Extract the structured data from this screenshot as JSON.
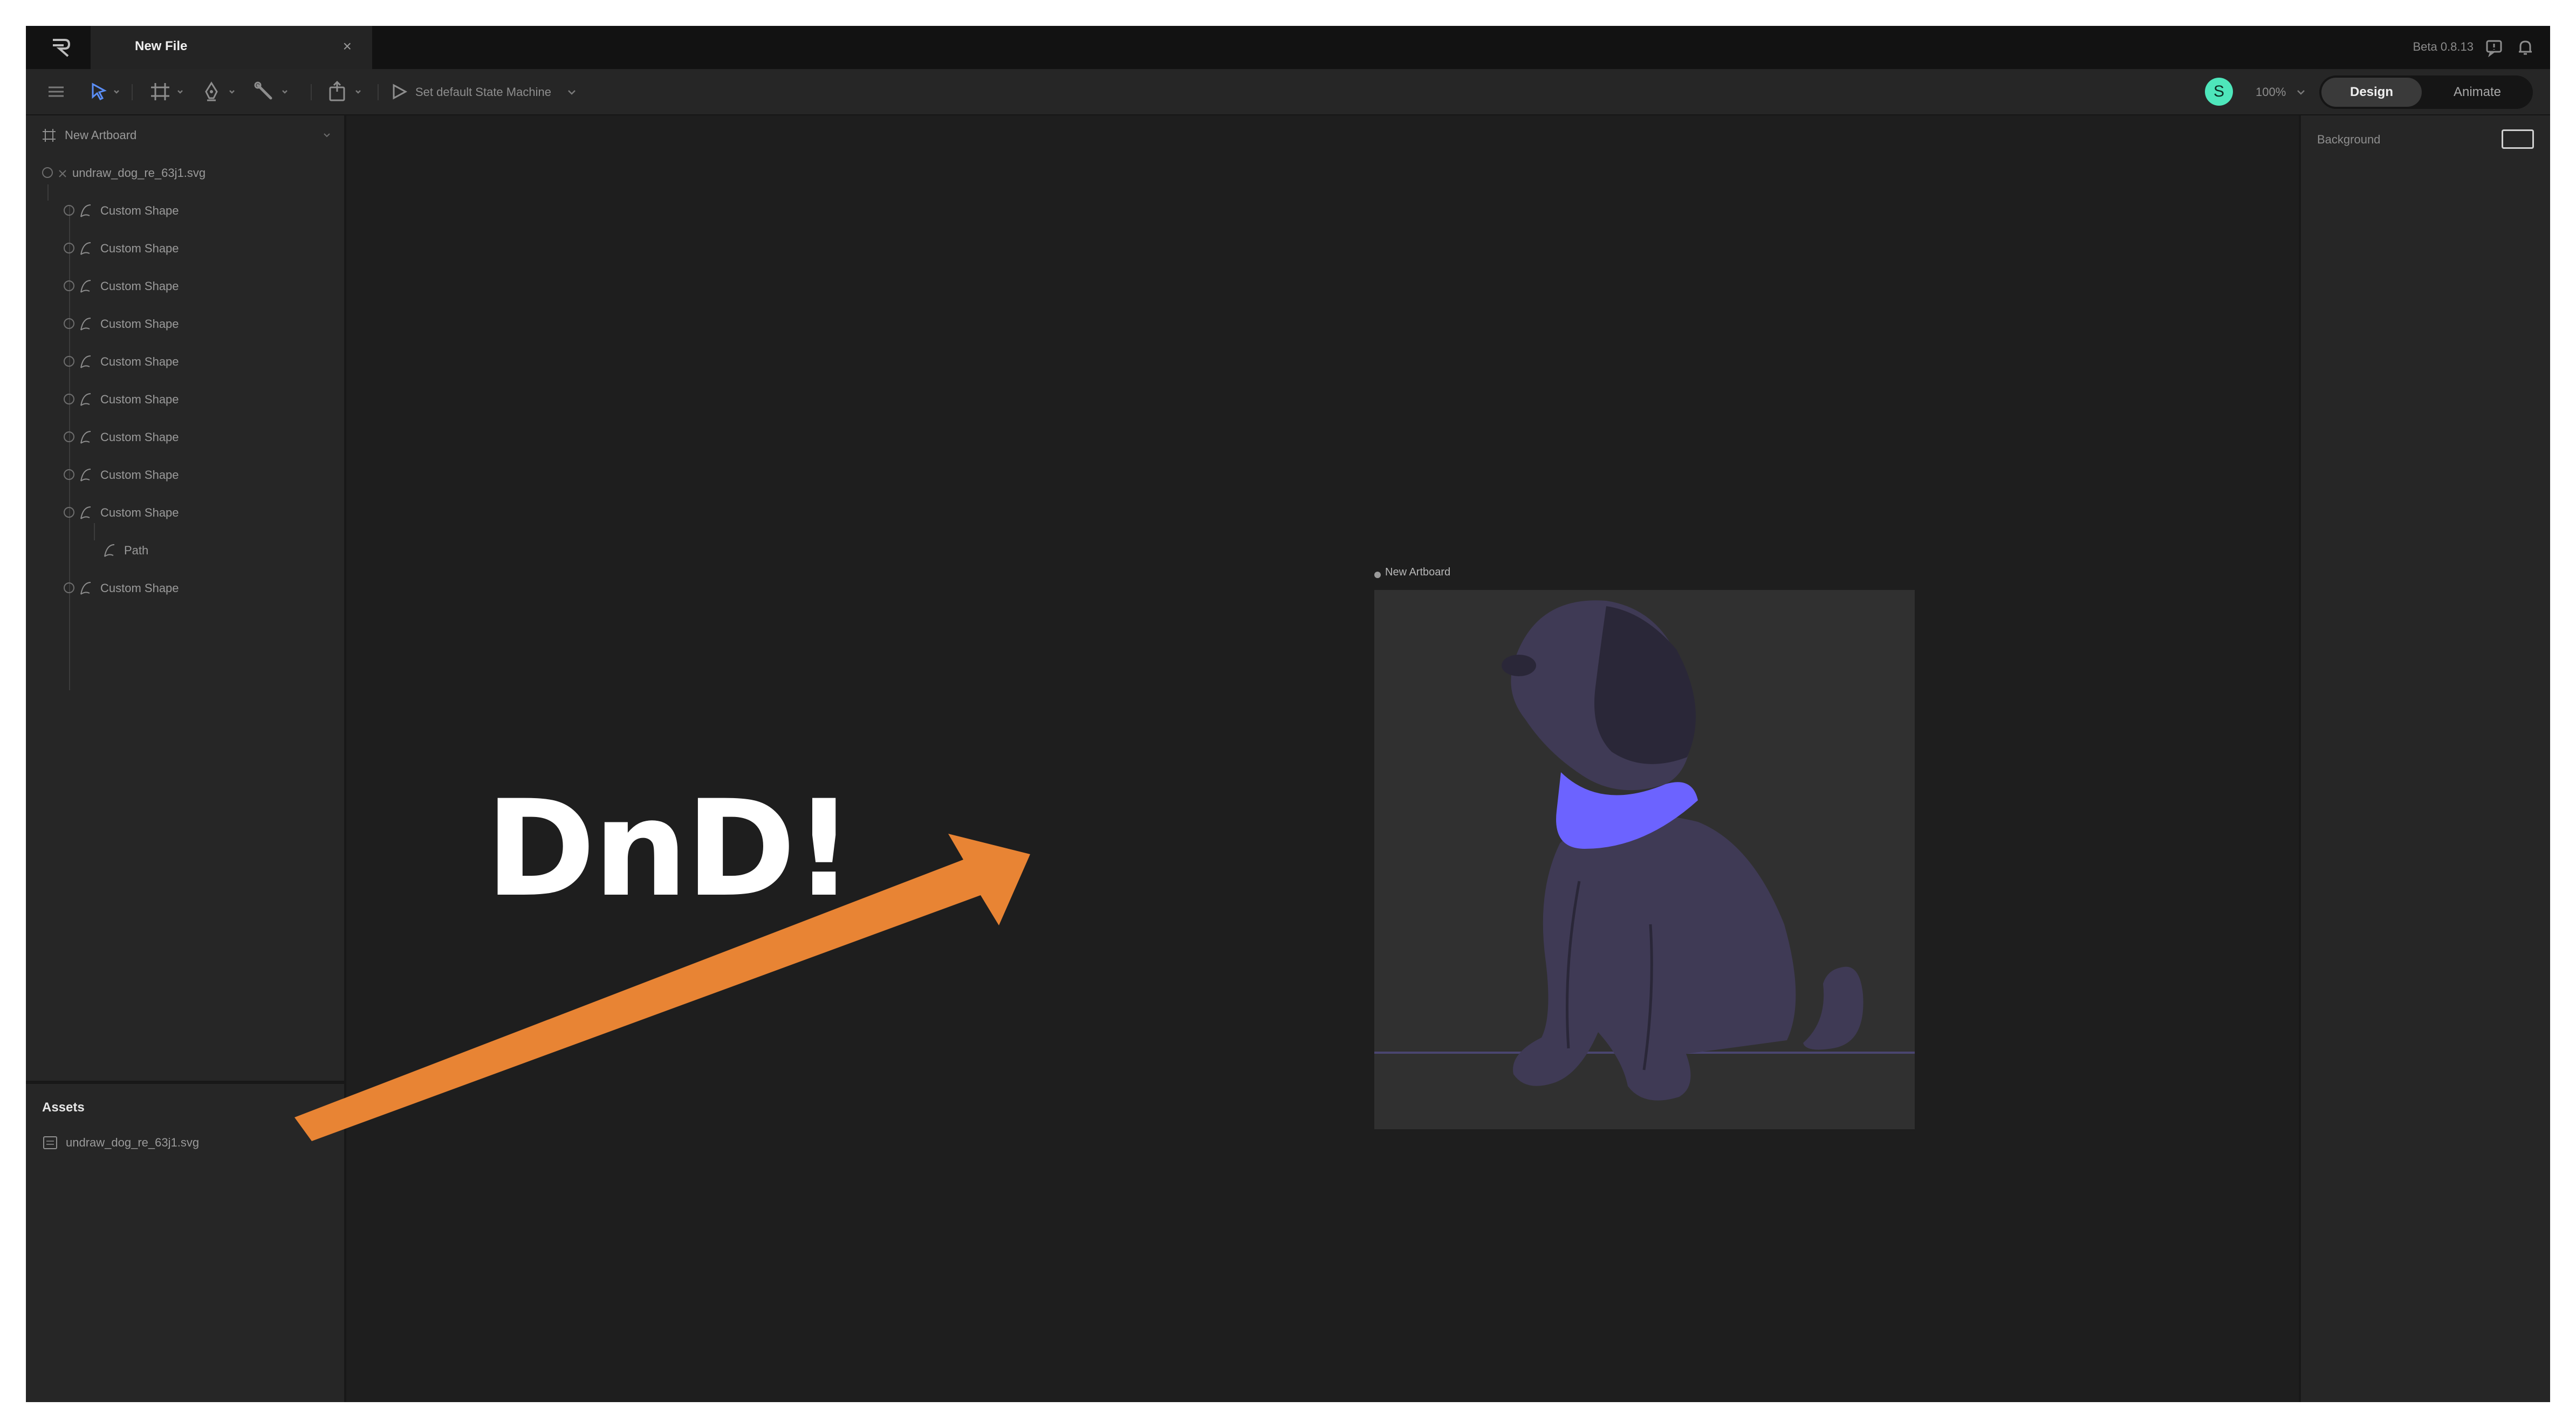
{
  "titlebar": {
    "tab_label": "New File",
    "close_glyph": "×",
    "version": "Beta 0.8.13"
  },
  "toolbar": {
    "state_machine_label": "Set default State Machine",
    "avatar_initial": "S",
    "zoom": "100%",
    "modes": [
      "Design",
      "Animate"
    ],
    "active_mode": "Design"
  },
  "hierarchy": {
    "artboard": "New Artboard",
    "svg_group": "undraw_dog_re_63j1.svg",
    "shape_label": "Custom Shape",
    "path_label": "Path"
  },
  "assets": {
    "title": "Assets",
    "items": [
      "undraw_dog_re_63j1.svg"
    ]
  },
  "canvas": {
    "artboard_label": "New Artboard"
  },
  "inspector": {
    "background_label": "Background"
  },
  "annotation": {
    "text": "DnD!",
    "arrow_color": "#e88434"
  },
  "colors": {
    "dog_body": "#3f3a55",
    "dog_ear": "#2a2738",
    "collar": "#6c63ff",
    "avatar": "#4ee6bb"
  }
}
